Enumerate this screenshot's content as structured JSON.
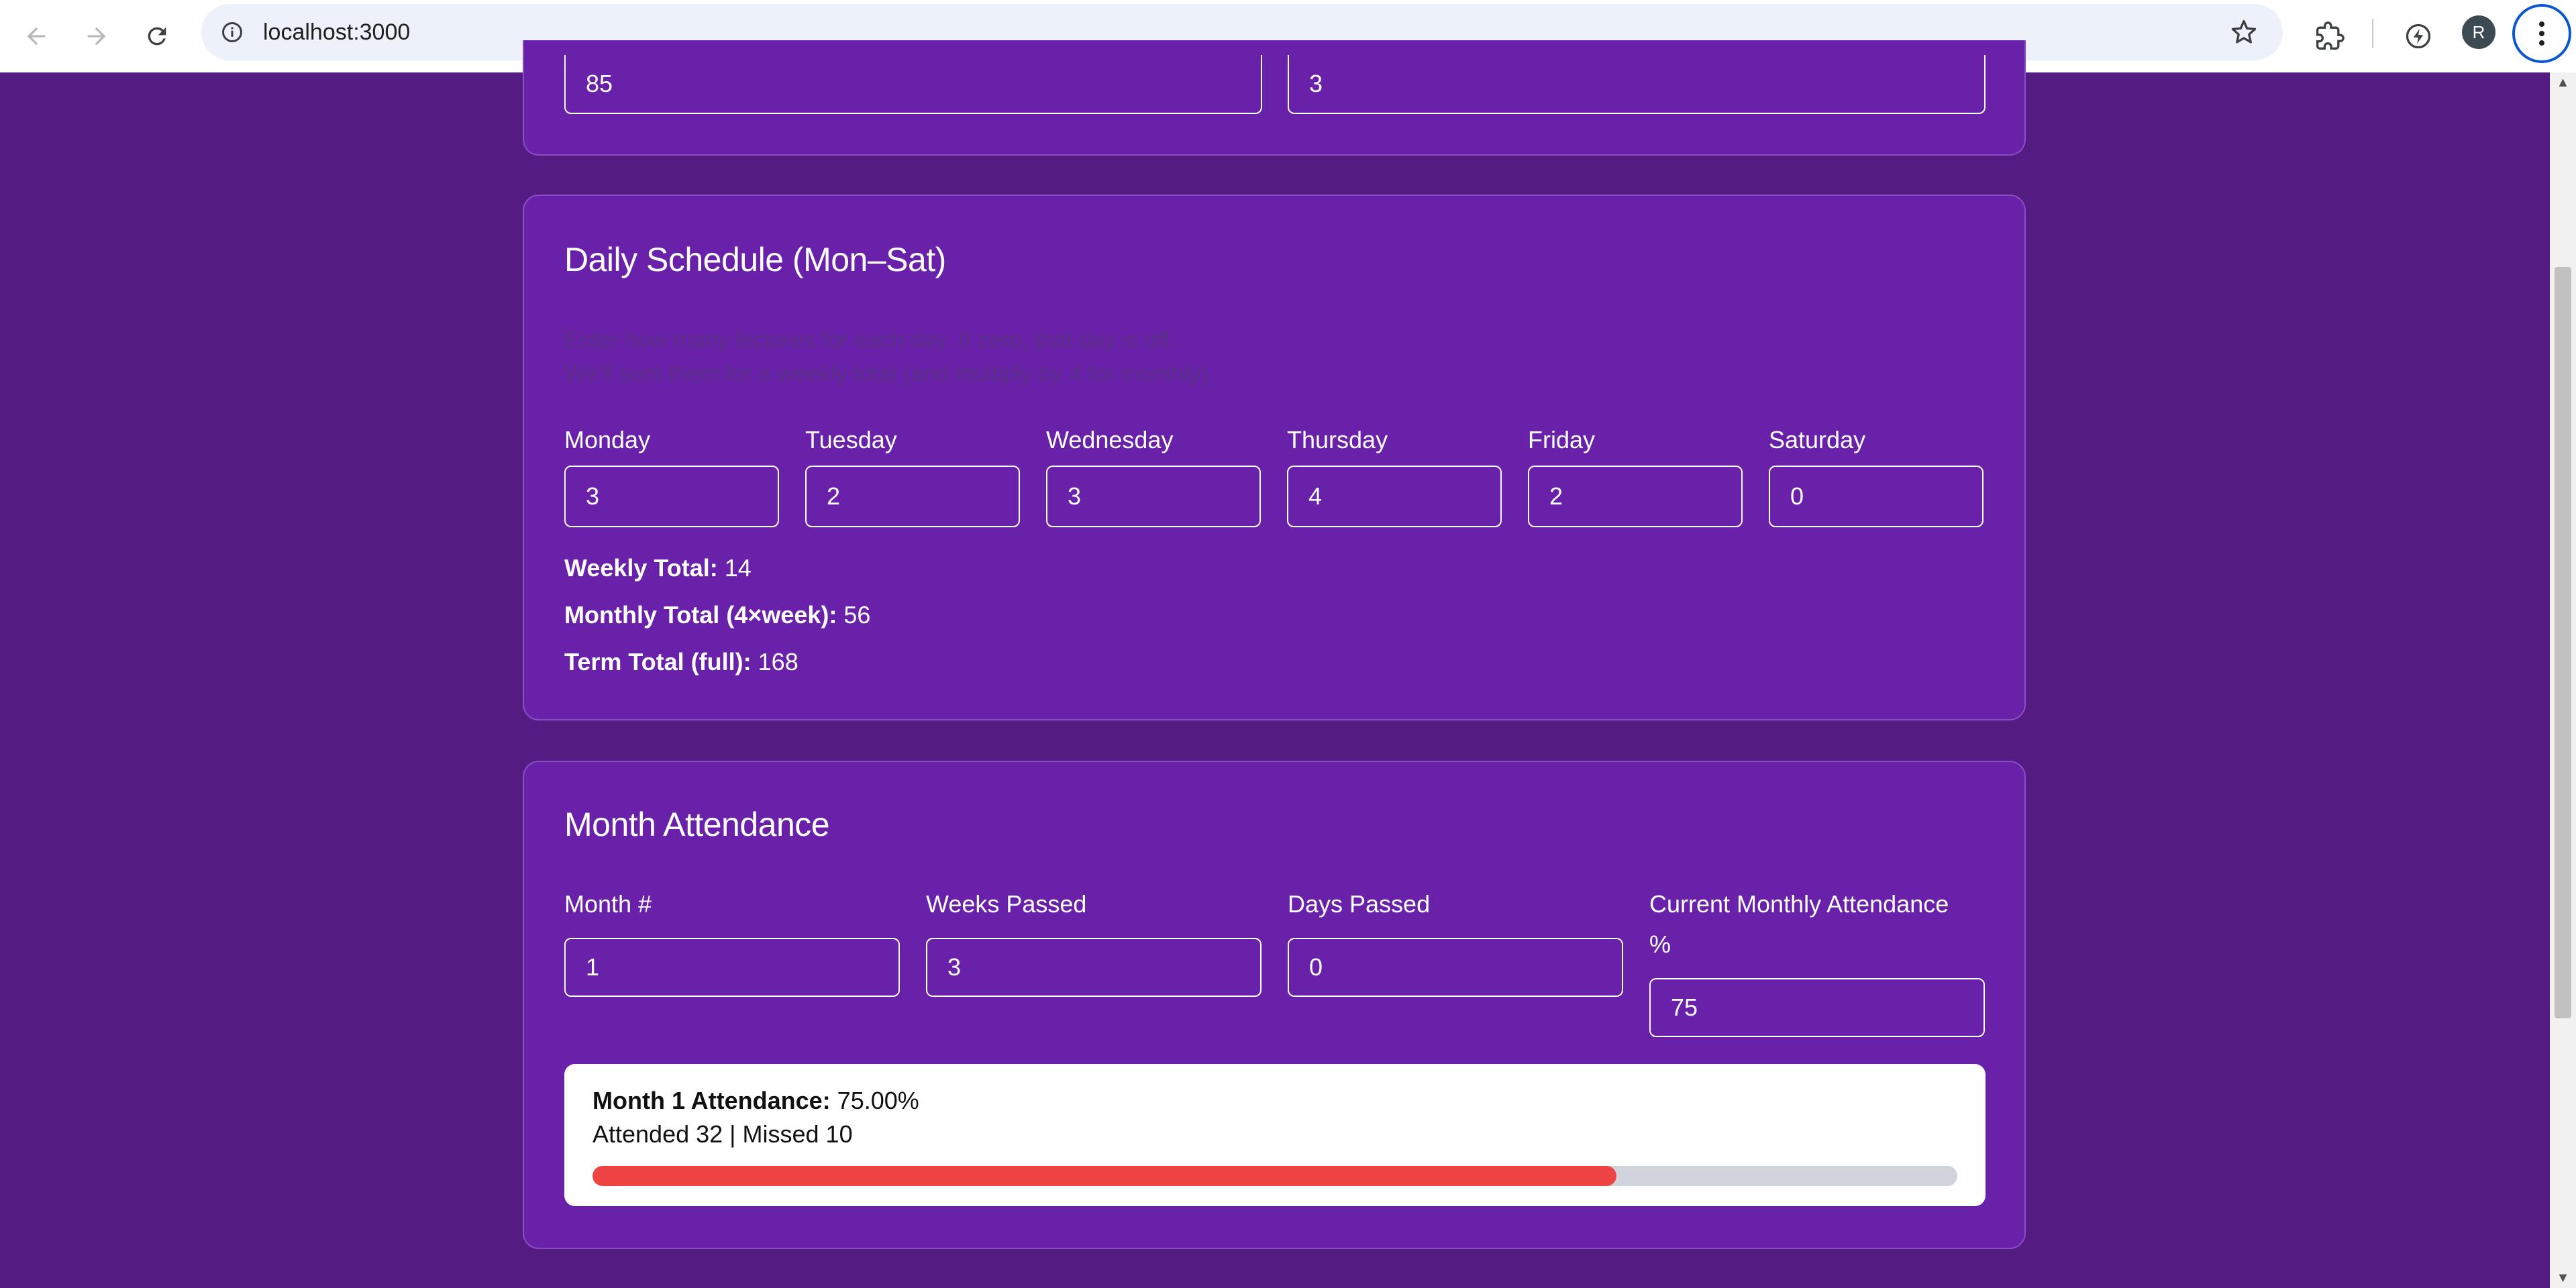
{
  "browser": {
    "url": "localhost:3000",
    "avatar_letter": "R"
  },
  "top_card": {
    "left_value": "85",
    "right_value": "3"
  },
  "schedule": {
    "title": "Daily Schedule (Mon–Sat)",
    "hint_line1": "Enter how many lectures for each day. If zero, that day is off.",
    "hint_line2": "We'll sum them for a weekly total (and multiply by 4 for monthly).",
    "days": [
      {
        "label": "Monday",
        "value": "3"
      },
      {
        "label": "Tuesday",
        "value": "2"
      },
      {
        "label": "Wednesday",
        "value": "3"
      },
      {
        "label": "Thursday",
        "value": "4"
      },
      {
        "label": "Friday",
        "value": "2"
      },
      {
        "label": "Saturday",
        "value": "0"
      }
    ],
    "weekly_label": "Weekly Total:",
    "weekly_value": "14",
    "monthly_label": "Monthly Total (4×week):",
    "monthly_value": "56",
    "term_label": "Term Total (full):",
    "term_value": "168"
  },
  "month": {
    "title": "Month Attendance",
    "fields": [
      {
        "label": "Month #",
        "value": "1"
      },
      {
        "label": "Weeks Passed",
        "value": "3"
      },
      {
        "label": "Days Passed",
        "value": "0"
      },
      {
        "label_line1": "Current Monthly Attendance",
        "label_line2": "%",
        "value": "75"
      }
    ],
    "result": {
      "label": "Month 1 Attendance:",
      "percent": "75.00%",
      "detail": "Attended 32 | Missed 10",
      "progress_fraction": 0.75,
      "bar_color": "#ef4444"
    }
  },
  "colors": {
    "page_bg": "#541c82",
    "card_bg": "#6a21aa"
  }
}
